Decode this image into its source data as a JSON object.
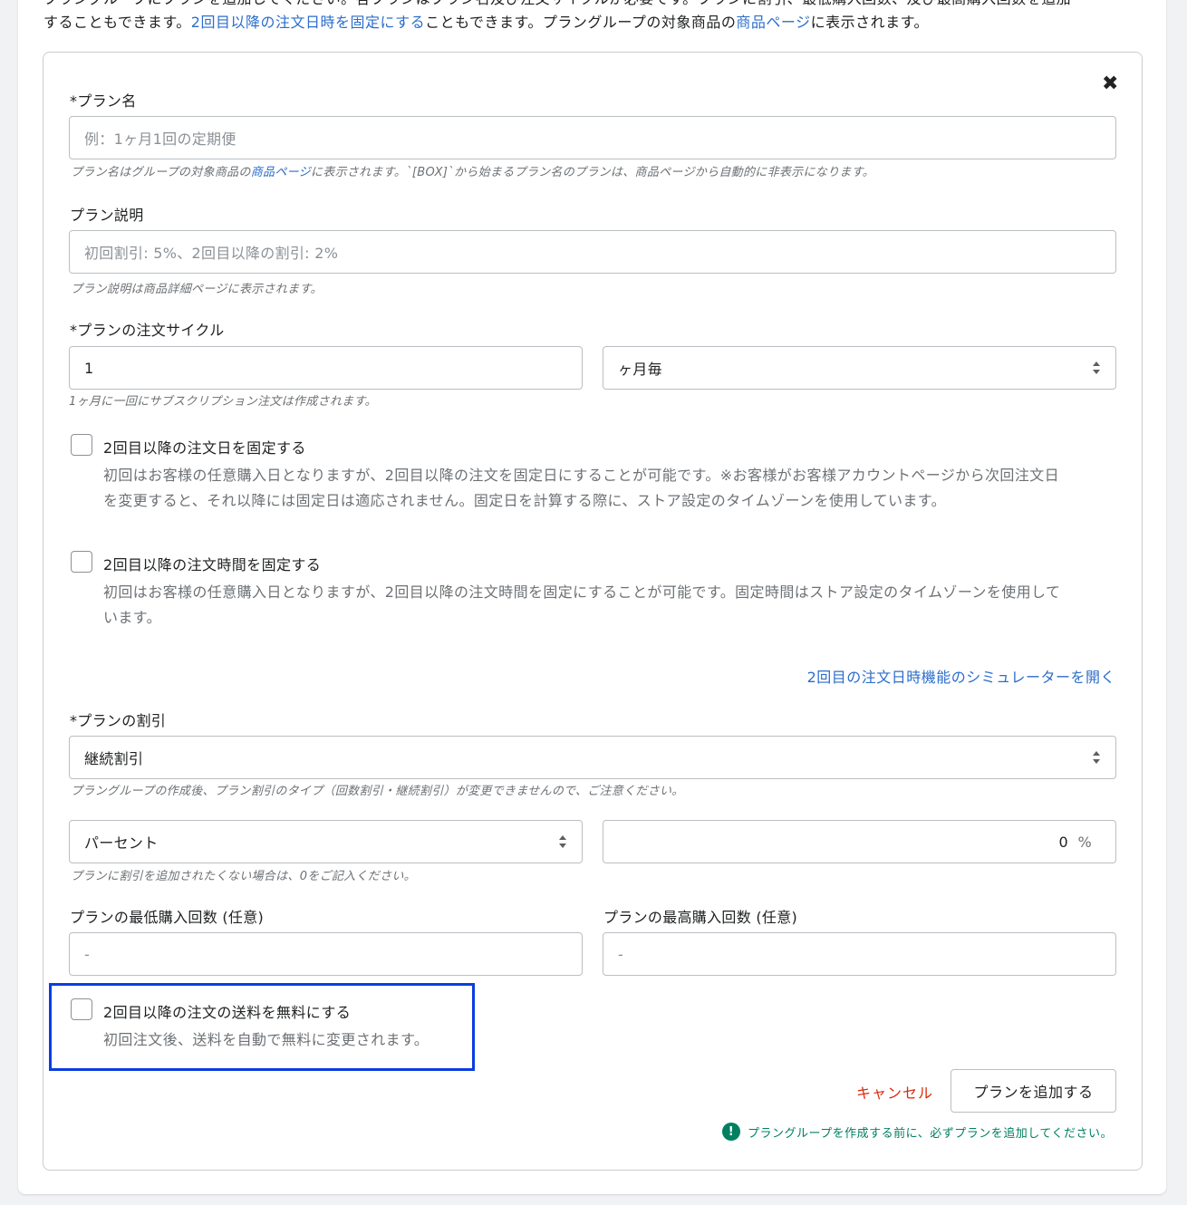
{
  "intro": {
    "line1_text": "プラングループにプランを追加してください。各プランはプラン名及び注文サイクルが必要です。プランに割引、最低購入回数、及び最高購入回数を追加",
    "line2_before": "することもできます。",
    "line2_link1": "2回目以降の注文日時を固定にする",
    "line2_middle": "こともできます。プラングループの対象商品の",
    "line2_link2": "商品ページ",
    "line2_after": "に表示されます。"
  },
  "form": {
    "close_symbol": "✖",
    "plan_name": {
      "label": "*プラン名",
      "placeholder": "例：1ヶ月1回の定期便",
      "help_before": "プラン名はグループの対象商品の",
      "help_link": "商品ページ",
      "help_after": "に表示されます。`[BOX]`から始まるプラン名のプランは、商品ページから自動的に非表示になります。"
    },
    "plan_description": {
      "label": "プラン説明",
      "placeholder": "初回割引: 5%、2回目以降の割引: 2%",
      "help": "プラン説明は商品詳細ページに表示されます。"
    },
    "order_cycle": {
      "label": "*プランの注文サイクル",
      "value": "1",
      "unit": "ヶ月毎",
      "help": "1ヶ月に一回にサブスクリプション注文は作成されます。"
    },
    "fix_date": {
      "title": "2回目以降の注文日を固定する",
      "desc_line1": "初回はお客様の任意購入日となりますが、2回目以降の注文を固定日にすることが可能です。※お客様がお客様アカウントページから次回注文日",
      "desc_line2": "を変更すると、それ以降には固定日は適応されません。固定日を計算する際に、ストア設定のタイムゾーンを使用しています。"
    },
    "fix_time": {
      "title": "2回目以降の注文時間を固定する",
      "desc_line1": "初回はお客様の任意購入日となりますが、2回目以降の注文時間を固定にすることが可能です。固定時間はストア設定のタイムゾーンを使用して",
      "desc_line2": "います。"
    },
    "simulator_link": "2回目の注文日時機能のシミュレーターを開く",
    "discount": {
      "label": "*プランの割引",
      "type_value": "継続割引",
      "type_help": "プラングループの作成後、プラン割引のタイプ（回数割引・継続割引）が変更できませんので、ご注意ください。",
      "unit_value": "パーセント",
      "amount": "0",
      "amount_suffix": "%",
      "amount_help": "プランに割引を追加されたくない場合は、0をご記入ください。"
    },
    "min_purchases": {
      "label": "プランの最低購入回数 (任意)",
      "placeholder": "-"
    },
    "max_purchases": {
      "label": "プランの最高購入回数 (任意)",
      "placeholder": "-"
    },
    "free_shipping": {
      "title": "2回目以降の注文の送料を無料にする",
      "desc": "初回注文後、送料を自動で無料に変更されます。"
    },
    "cancel_label": "キャンセル",
    "add_plan_label": "プランを追加する",
    "notice": "プラングループを作成する前に、必ずプランを追加してください。",
    "notice_icon": "!"
  },
  "colors": {
    "link": "#2c6ecb",
    "cancel": "#d82c0d",
    "notice": "#008060",
    "highlight": "#0b3de0"
  }
}
